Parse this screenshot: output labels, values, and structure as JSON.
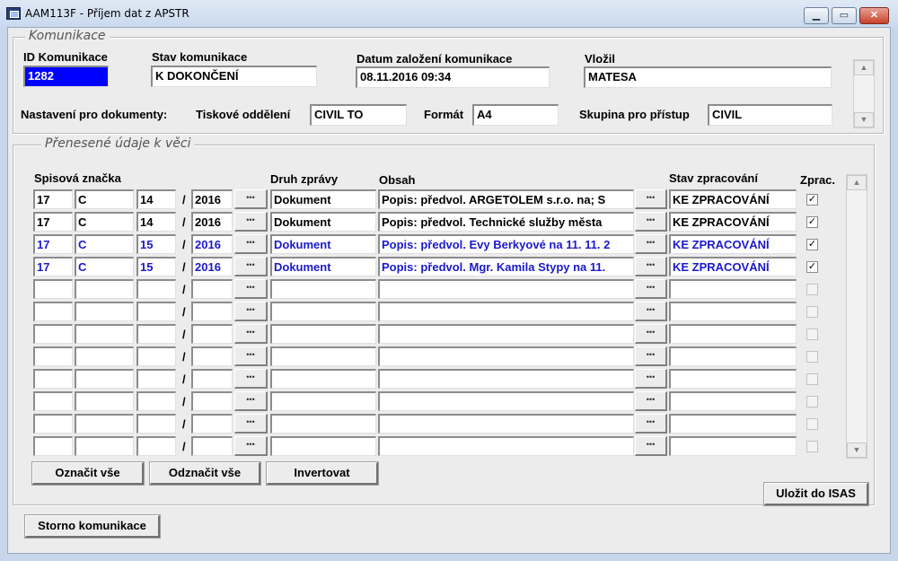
{
  "window": {
    "title": "AAM113F - Příjem dat z APSTR"
  },
  "komunikace": {
    "legend": "Komunikace",
    "id_label": "ID Komunikace",
    "id_value": "1282",
    "stav_label": "Stav komunikace",
    "stav_value": "K DOKONČENÍ",
    "datum_label": "Datum založení komunikace",
    "datum_value": "08.11.2016 09:34",
    "vlozil_label": "Vložil",
    "vlozil_value": "MATESA",
    "nastaveni_label": "Nastavení pro dokumenty:",
    "tiskove_label": "Tiskové oddělení",
    "tiskove_value": "CIVIL TO",
    "format_label": "Formát",
    "format_value": "A4",
    "skupina_label": "Skupina pro přístup",
    "skupina_value": "CIVIL"
  },
  "udaje": {
    "legend": "Přenesené údaje k věci",
    "headers": {
      "spisova": "Spisová značka",
      "druh": "Druh zprávy",
      "obsah": "Obsah",
      "stav": "Stav zpracování",
      "zprac": "Zprac."
    },
    "slash": "/",
    "dots": "•••",
    "rows": [
      {
        "a": "17",
        "b": "C",
        "c": "14",
        "d": "2016",
        "druh": "Dokument",
        "obsah": "Popis: předvol. ARGETOLEM s.r.o. na; S",
        "stav": "KE ZPRACOVÁNÍ",
        "check": "✓",
        "style": ""
      },
      {
        "a": "17",
        "b": "C",
        "c": "14",
        "d": "2016",
        "druh": "Dokument",
        "obsah": "Popis: předvol. Technické služby města",
        "stav": "KE ZPRACOVÁNÍ",
        "check": "✓",
        "style": ""
      },
      {
        "a": "17",
        "b": "C",
        "c": "15",
        "d": "2016",
        "druh": "Dokument",
        "obsah": "Popis: předvol. Evy Berkyové na 11. 11. 2",
        "stav": "KE ZPRACOVÁNÍ",
        "check": "✓",
        "style": "blue"
      },
      {
        "a": "17",
        "b": "C",
        "c": "15",
        "d": "2016",
        "druh": "Dokument",
        "obsah": "Popis: předvol. Mgr. Kamila Stypy na 11.",
        "stav": "KE ZPRACOVÁNÍ",
        "check": "✓",
        "style": "blue"
      },
      {
        "a": "",
        "b": "",
        "c": "",
        "d": "",
        "druh": "",
        "obsah": "",
        "stav": "",
        "check": "",
        "style": ""
      },
      {
        "a": "",
        "b": "",
        "c": "",
        "d": "",
        "druh": "",
        "obsah": "",
        "stav": "",
        "check": "",
        "style": ""
      },
      {
        "a": "",
        "b": "",
        "c": "",
        "d": "",
        "druh": "",
        "obsah": "",
        "stav": "",
        "check": "",
        "style": ""
      },
      {
        "a": "",
        "b": "",
        "c": "",
        "d": "",
        "druh": "",
        "obsah": "",
        "stav": "",
        "check": "",
        "style": ""
      },
      {
        "a": "",
        "b": "",
        "c": "",
        "d": "",
        "druh": "",
        "obsah": "",
        "stav": "",
        "check": "",
        "style": ""
      },
      {
        "a": "",
        "b": "",
        "c": "",
        "d": "",
        "druh": "",
        "obsah": "",
        "stav": "",
        "check": "",
        "style": ""
      },
      {
        "a": "",
        "b": "",
        "c": "",
        "d": "",
        "druh": "",
        "obsah": "",
        "stav": "",
        "check": "",
        "style": ""
      },
      {
        "a": "",
        "b": "",
        "c": "",
        "d": "",
        "druh": "",
        "obsah": "",
        "stav": "",
        "check": "",
        "style": ""
      }
    ]
  },
  "buttons": {
    "oznacit": "Označit vše",
    "odznacit": "Odznačit vše",
    "invertovat": "Invertovat",
    "ulozit": "Uložit do ISAS",
    "storno": "Storno komunikace"
  },
  "colors": {
    "selected_bg": "#0000ff",
    "row_text_blue": "#1a1acc",
    "dots_cyan": "#2aa6c6"
  }
}
